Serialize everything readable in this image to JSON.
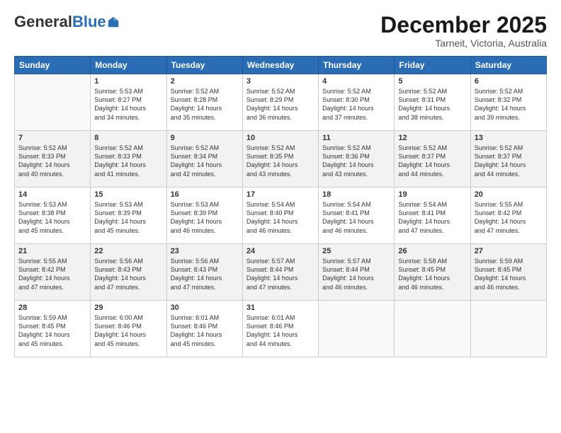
{
  "logo": {
    "general": "General",
    "blue": "Blue"
  },
  "title": "December 2025",
  "subtitle": "Tarneit, Victoria, Australia",
  "days": [
    "Sunday",
    "Monday",
    "Tuesday",
    "Wednesday",
    "Thursday",
    "Friday",
    "Saturday"
  ],
  "weeks": [
    [
      {
        "num": "",
        "info": ""
      },
      {
        "num": "1",
        "info": "Sunrise: 5:53 AM\nSunset: 8:27 PM\nDaylight: 14 hours\nand 34 minutes."
      },
      {
        "num": "2",
        "info": "Sunrise: 5:52 AM\nSunset: 8:28 PM\nDaylight: 14 hours\nand 35 minutes."
      },
      {
        "num": "3",
        "info": "Sunrise: 5:52 AM\nSunset: 8:29 PM\nDaylight: 14 hours\nand 36 minutes."
      },
      {
        "num": "4",
        "info": "Sunrise: 5:52 AM\nSunset: 8:30 PM\nDaylight: 14 hours\nand 37 minutes."
      },
      {
        "num": "5",
        "info": "Sunrise: 5:52 AM\nSunset: 8:31 PM\nDaylight: 14 hours\nand 38 minutes."
      },
      {
        "num": "6",
        "info": "Sunrise: 5:52 AM\nSunset: 8:32 PM\nDaylight: 14 hours\nand 39 minutes."
      }
    ],
    [
      {
        "num": "7",
        "info": "Sunrise: 5:52 AM\nSunset: 8:33 PM\nDaylight: 14 hours\nand 40 minutes."
      },
      {
        "num": "8",
        "info": "Sunrise: 5:52 AM\nSunset: 8:33 PM\nDaylight: 14 hours\nand 41 minutes."
      },
      {
        "num": "9",
        "info": "Sunrise: 5:52 AM\nSunset: 8:34 PM\nDaylight: 14 hours\nand 42 minutes."
      },
      {
        "num": "10",
        "info": "Sunrise: 5:52 AM\nSunset: 8:35 PM\nDaylight: 14 hours\nand 43 minutes."
      },
      {
        "num": "11",
        "info": "Sunrise: 5:52 AM\nSunset: 8:36 PM\nDaylight: 14 hours\nand 43 minutes."
      },
      {
        "num": "12",
        "info": "Sunrise: 5:52 AM\nSunset: 8:37 PM\nDaylight: 14 hours\nand 44 minutes."
      },
      {
        "num": "13",
        "info": "Sunrise: 5:52 AM\nSunset: 8:37 PM\nDaylight: 14 hours\nand 44 minutes."
      }
    ],
    [
      {
        "num": "14",
        "info": "Sunrise: 5:53 AM\nSunset: 8:38 PM\nDaylight: 14 hours\nand 45 minutes."
      },
      {
        "num": "15",
        "info": "Sunrise: 5:53 AM\nSunset: 8:39 PM\nDaylight: 14 hours\nand 45 minutes."
      },
      {
        "num": "16",
        "info": "Sunrise: 5:53 AM\nSunset: 8:39 PM\nDaylight: 14 hours\nand 46 minutes."
      },
      {
        "num": "17",
        "info": "Sunrise: 5:54 AM\nSunset: 8:40 PM\nDaylight: 14 hours\nand 46 minutes."
      },
      {
        "num": "18",
        "info": "Sunrise: 5:54 AM\nSunset: 8:41 PM\nDaylight: 14 hours\nand 46 minutes."
      },
      {
        "num": "19",
        "info": "Sunrise: 5:54 AM\nSunset: 8:41 PM\nDaylight: 14 hours\nand 47 minutes."
      },
      {
        "num": "20",
        "info": "Sunrise: 5:55 AM\nSunset: 8:42 PM\nDaylight: 14 hours\nand 47 minutes."
      }
    ],
    [
      {
        "num": "21",
        "info": "Sunrise: 5:55 AM\nSunset: 8:42 PM\nDaylight: 14 hours\nand 47 minutes."
      },
      {
        "num": "22",
        "info": "Sunrise: 5:56 AM\nSunset: 8:43 PM\nDaylight: 14 hours\nand 47 minutes."
      },
      {
        "num": "23",
        "info": "Sunrise: 5:56 AM\nSunset: 8:43 PM\nDaylight: 14 hours\nand 47 minutes."
      },
      {
        "num": "24",
        "info": "Sunrise: 5:57 AM\nSunset: 8:44 PM\nDaylight: 14 hours\nand 47 minutes."
      },
      {
        "num": "25",
        "info": "Sunrise: 5:57 AM\nSunset: 8:44 PM\nDaylight: 14 hours\nand 46 minutes."
      },
      {
        "num": "26",
        "info": "Sunrise: 5:58 AM\nSunset: 8:45 PM\nDaylight: 14 hours\nand 46 minutes."
      },
      {
        "num": "27",
        "info": "Sunrise: 5:59 AM\nSunset: 8:45 PM\nDaylight: 14 hours\nand 46 minutes."
      }
    ],
    [
      {
        "num": "28",
        "info": "Sunrise: 5:59 AM\nSunset: 8:45 PM\nDaylight: 14 hours\nand 45 minutes."
      },
      {
        "num": "29",
        "info": "Sunrise: 6:00 AM\nSunset: 8:46 PM\nDaylight: 14 hours\nand 45 minutes."
      },
      {
        "num": "30",
        "info": "Sunrise: 6:01 AM\nSunset: 8:46 PM\nDaylight: 14 hours\nand 45 minutes."
      },
      {
        "num": "31",
        "info": "Sunrise: 6:01 AM\nSunset: 8:46 PM\nDaylight: 14 hours\nand 44 minutes."
      },
      {
        "num": "",
        "info": ""
      },
      {
        "num": "",
        "info": ""
      },
      {
        "num": "",
        "info": ""
      }
    ]
  ]
}
